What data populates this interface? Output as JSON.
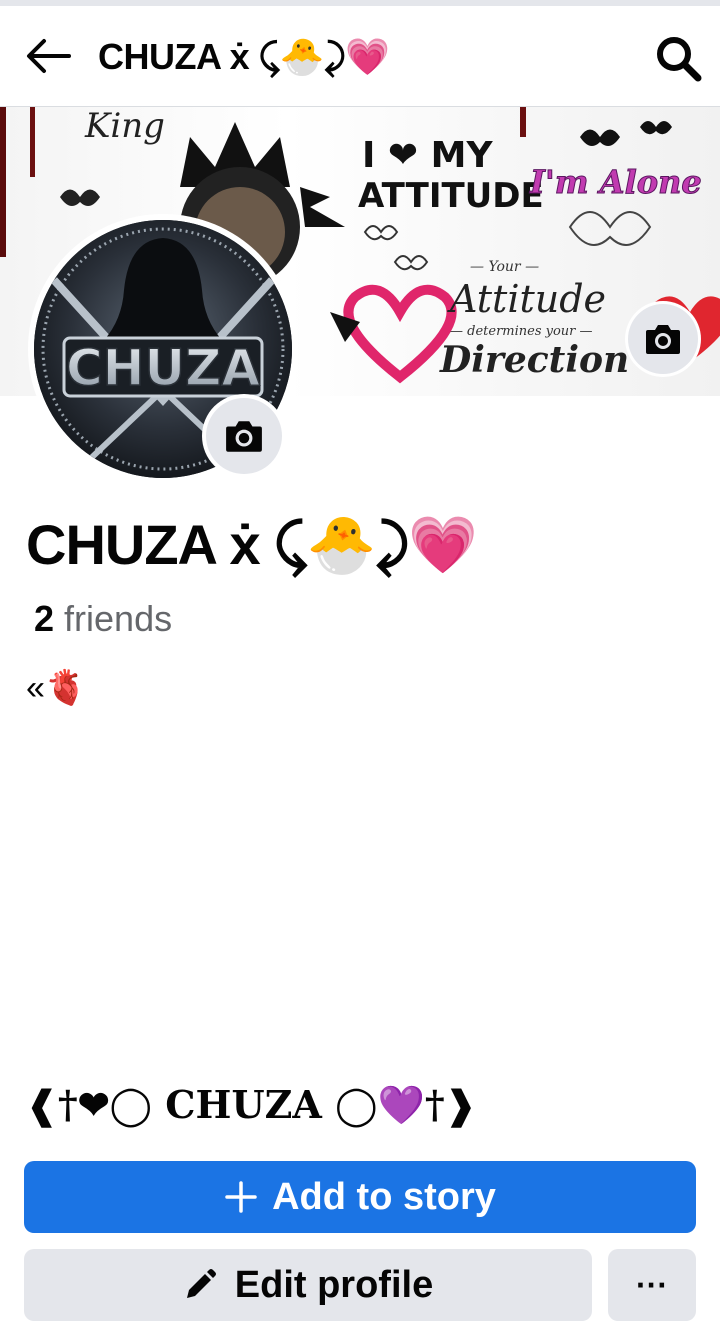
{
  "header": {
    "title": "CHUZA ẋ ⤹🐣⤸💗"
  },
  "cover": {
    "texts": {
      "i_love": "I ❤ MY",
      "attitude_caps": "ATTITUDE",
      "im_alone": "I'm Alone",
      "your": "— Your —",
      "attitude": "Attitude",
      "determines": "— determines your —",
      "direction": "Direction",
      "king": "King"
    }
  },
  "avatar": {
    "logo_text": "CHUZA"
  },
  "profile": {
    "name": "CHUZA ẋ ⤹🐣⤸💗",
    "friends_count": "2",
    "friends_label": " friends",
    "bio": "«🫀",
    "tagline": "❰†❤◯  CHUZA  ◯💜†❱"
  },
  "actions": {
    "add_story": "Add to story",
    "edit_profile": "Edit profile",
    "more": "···"
  },
  "colors": {
    "primary": "#1b74e4",
    "secondary_bg": "#e4e6eb",
    "text_muted": "#65676b"
  }
}
